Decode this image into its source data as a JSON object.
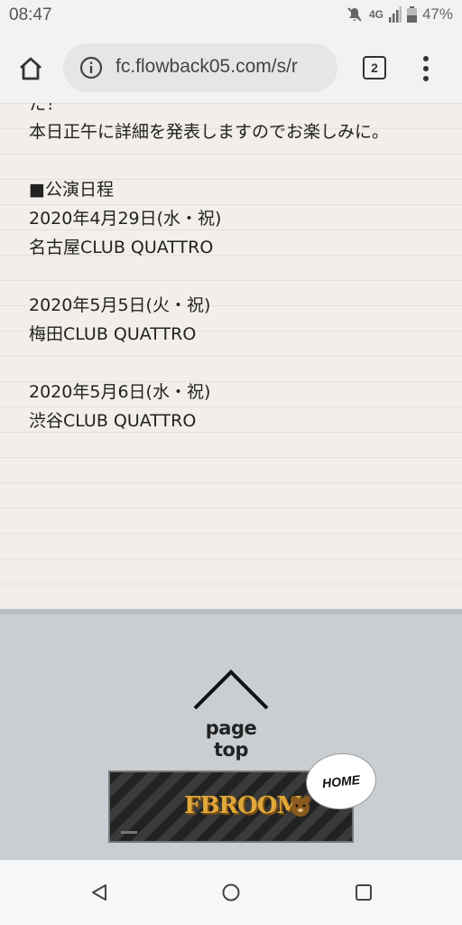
{
  "status": {
    "time": "08:47",
    "network": "4G",
    "battery": "47%",
    "icons": [
      "mute-icon",
      "signal-icon",
      "battery-icon"
    ]
  },
  "browser": {
    "url": "fc.flowback05.com/s/r",
    "tab_count": "2",
    "icons": [
      "home-icon",
      "info-icon",
      "menu-icon"
    ]
  },
  "article": {
    "cut_line": "た！",
    "lines": [
      "本日正午に詳細を発表しますのでお楽しみに。",
      "",
      "■公演日程",
      "2020年4月29日(水・祝)",
      "名古屋CLUB QUATTRO",
      "",
      "2020年5月5日(火・祝)",
      "梅田CLUB QUATTRO",
      "",
      "2020年5月6日(水・祝)",
      "渋谷CLUB QUATTRO"
    ]
  },
  "footer": {
    "page_top_label": "page top",
    "banner_logo": "FBROOM",
    "home_label": "HOME"
  },
  "navigation": {
    "icons": [
      "back-icon",
      "home-circle-icon",
      "recents-icon"
    ]
  }
}
